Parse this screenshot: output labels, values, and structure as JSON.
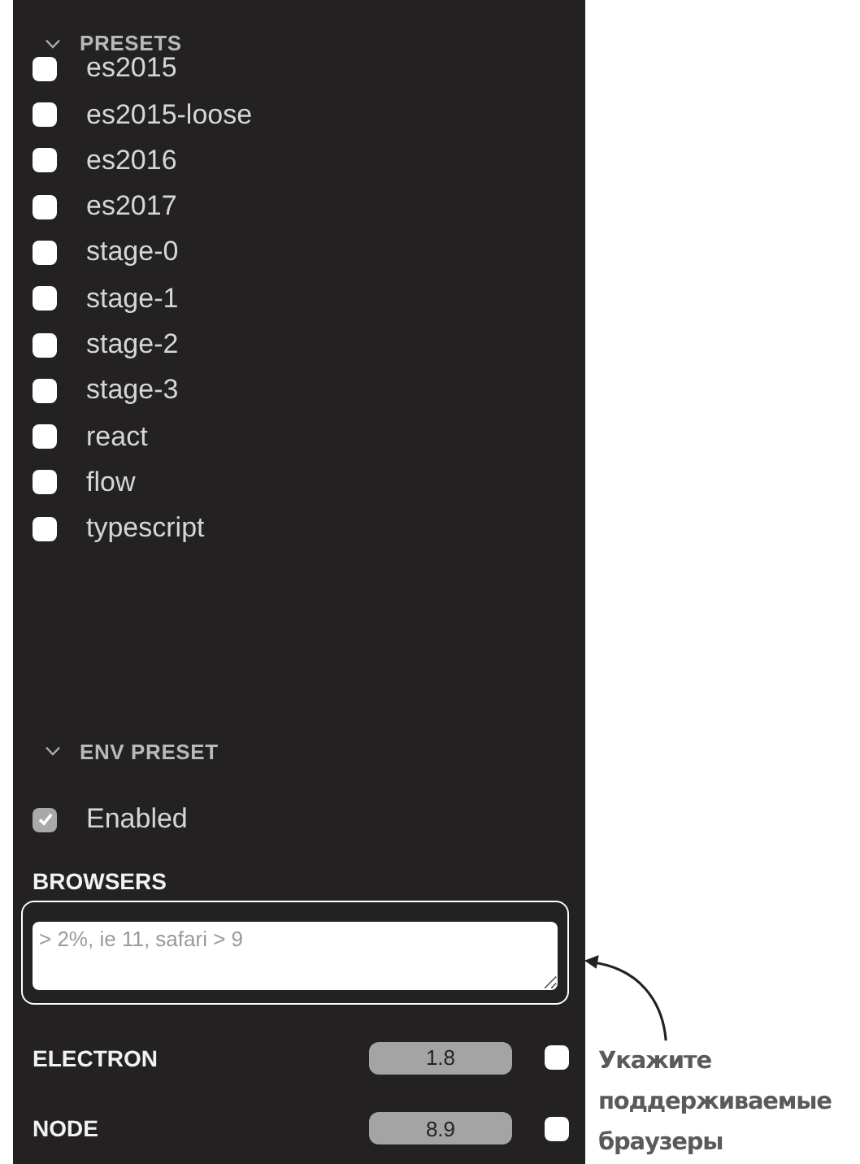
{
  "presets": {
    "title": "PRESETS",
    "expanded": true,
    "items": [
      {
        "label": "es2015",
        "checked": false
      },
      {
        "label": "es2015-loose",
        "checked": false
      },
      {
        "label": "es2016",
        "checked": false
      },
      {
        "label": "es2017",
        "checked": false
      },
      {
        "label": "stage-0",
        "checked": false
      },
      {
        "label": "stage-1",
        "checked": false
      },
      {
        "label": "stage-2",
        "checked": false
      },
      {
        "label": "stage-3",
        "checked": false
      },
      {
        "label": "react",
        "checked": false
      },
      {
        "label": "flow",
        "checked": false
      },
      {
        "label": "typescript",
        "checked": false
      }
    ]
  },
  "env_preset": {
    "title": "ENV PRESET",
    "expanded": true,
    "enabled": {
      "label": "Enabled",
      "checked": true
    },
    "browsers": {
      "label": "BROWSERS",
      "placeholder": "> 2%, ie 11, safari > 9"
    },
    "versions": [
      {
        "label": "ELECTRON",
        "value": "1.8",
        "checked": false
      },
      {
        "label": "NODE",
        "value": "8.9",
        "checked": false
      }
    ]
  },
  "annotation": {
    "text": "Укажите поддерживаемые браузеры"
  }
}
